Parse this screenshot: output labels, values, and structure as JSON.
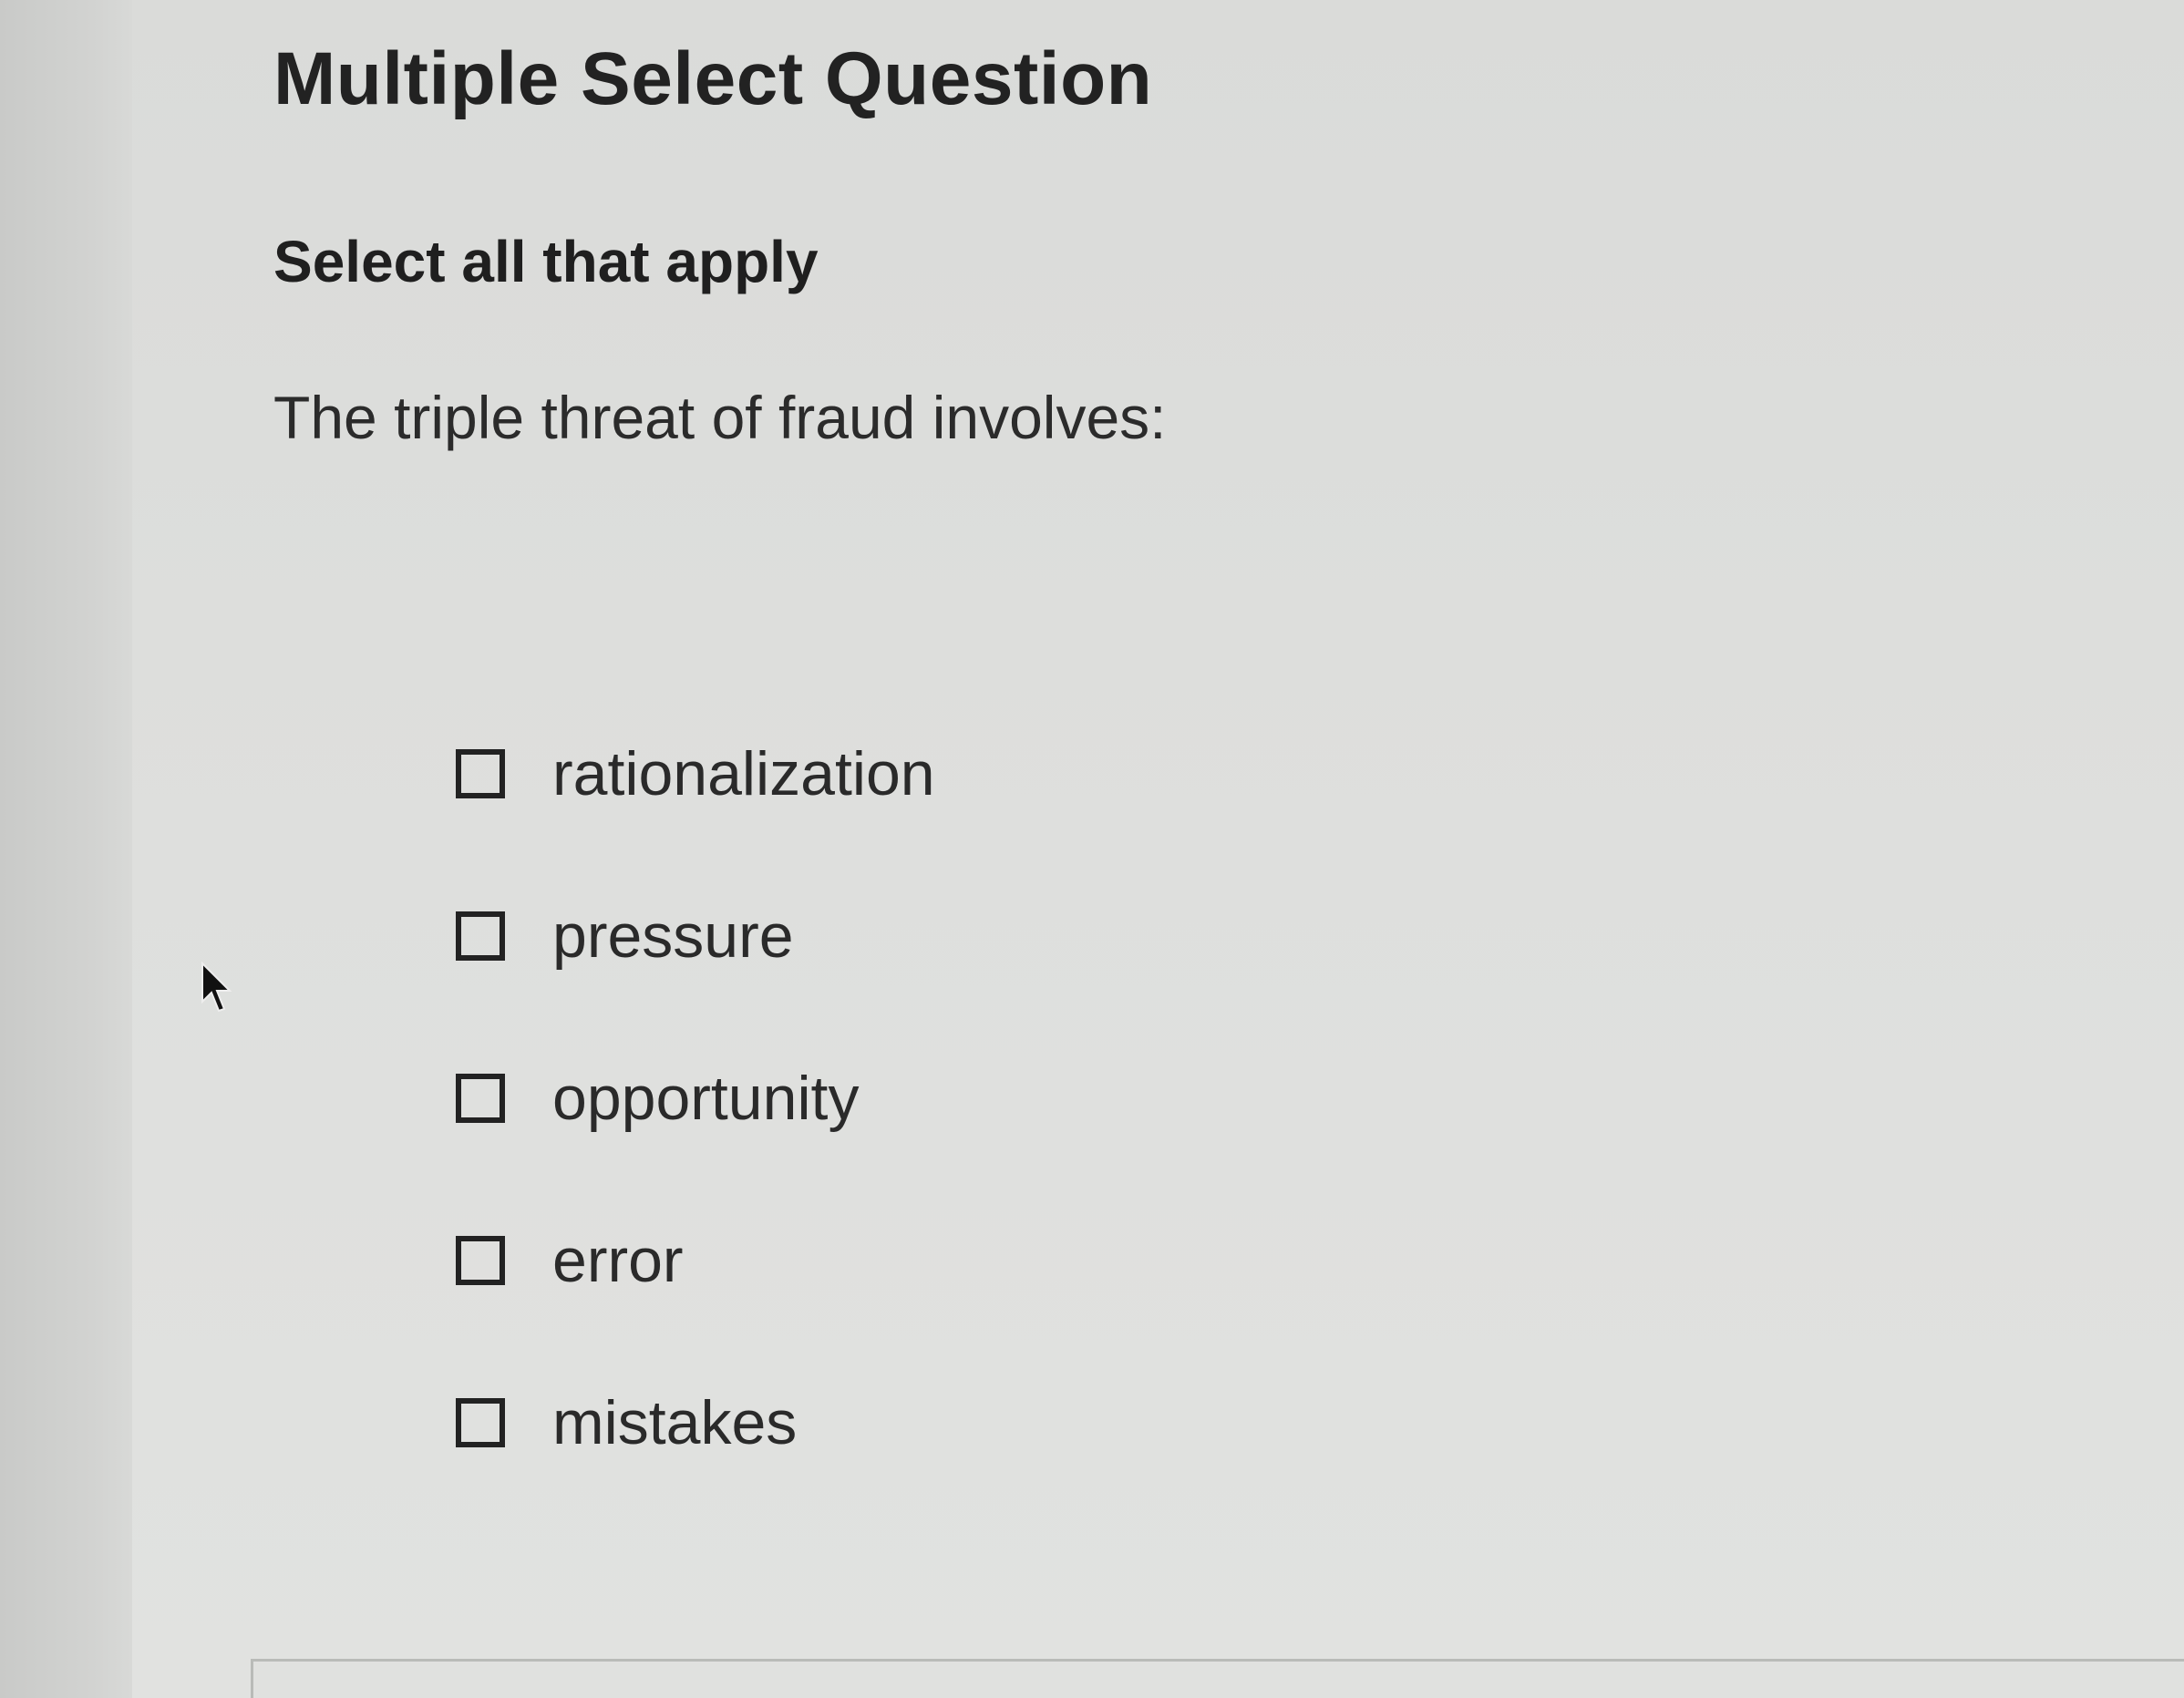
{
  "question": {
    "title": "Multiple Select Question",
    "instruction": "Select all that apply",
    "prompt": "The triple threat of fraud involves:"
  },
  "options": [
    {
      "label": "rationalization",
      "checked": false
    },
    {
      "label": "pressure",
      "checked": false
    },
    {
      "label": "opportunity",
      "checked": false
    },
    {
      "label": "error",
      "checked": false
    },
    {
      "label": "mistakes",
      "checked": false
    }
  ]
}
